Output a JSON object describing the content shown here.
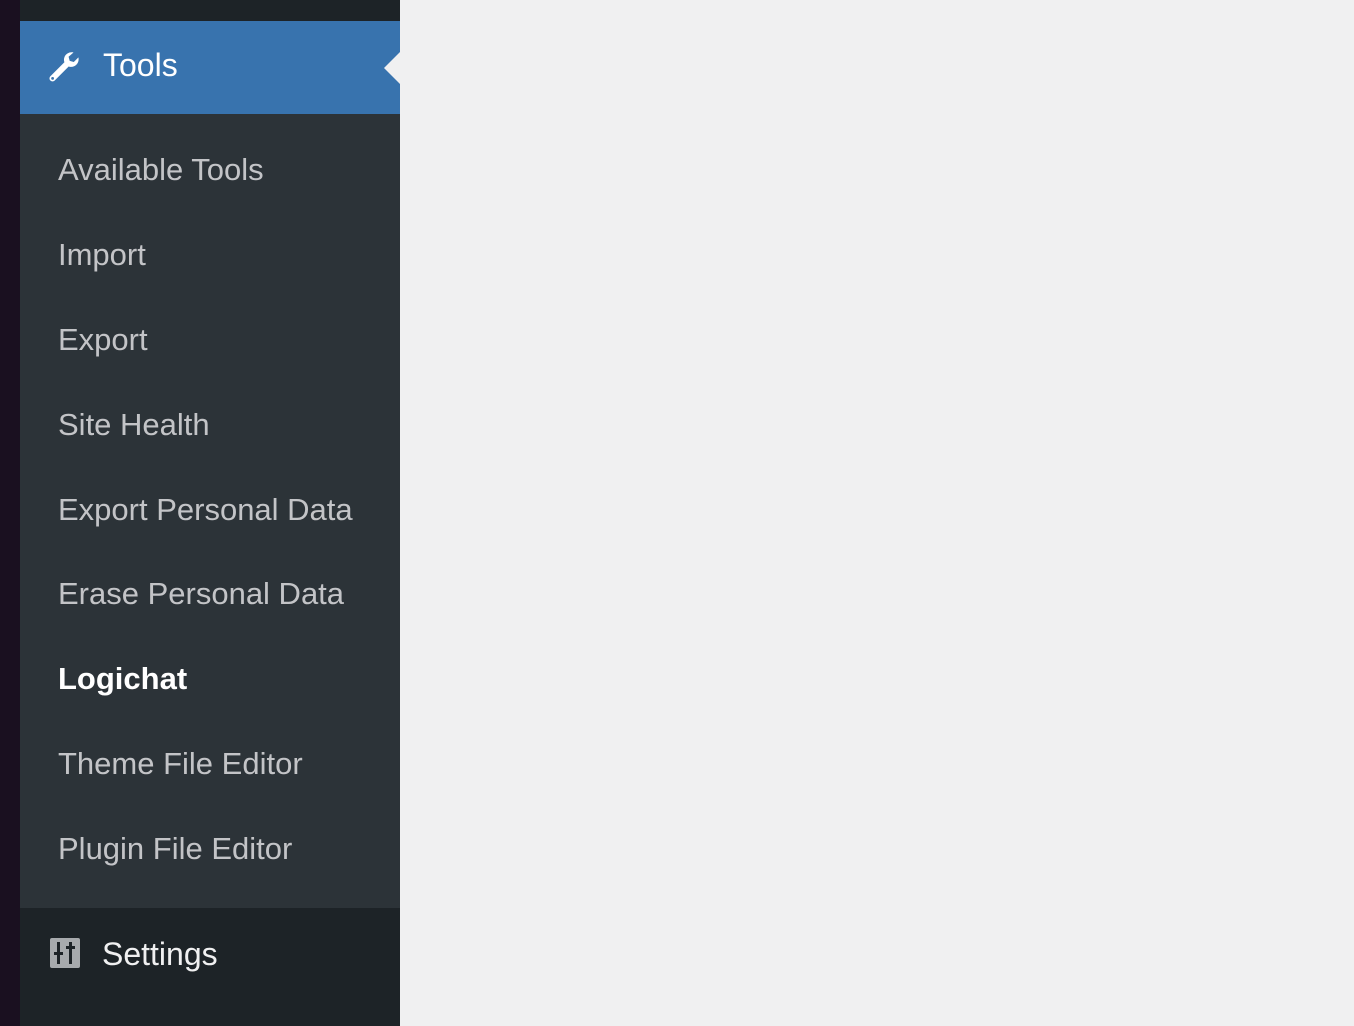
{
  "admin_menu": {
    "tools": {
      "label": "Tools",
      "icon": "wrench-icon"
    },
    "submenu": [
      {
        "label": "Available Tools",
        "current": false
      },
      {
        "label": "Import",
        "current": false
      },
      {
        "label": "Export",
        "current": false
      },
      {
        "label": "Site Health",
        "current": false
      },
      {
        "label": "Export Personal Data",
        "current": false
      },
      {
        "label": "Erase Personal Data",
        "current": false
      },
      {
        "label": "Logichat",
        "current": true
      },
      {
        "label": "Theme File Editor",
        "current": false
      },
      {
        "label": "Plugin File Editor",
        "current": false
      }
    ],
    "settings": {
      "label": "Settings",
      "icon": "sliders-icon"
    }
  },
  "colors": {
    "menu_background": "#1d2327",
    "submenu_background": "#2c3338",
    "active_highlight": "#3873ae",
    "content_background": "#f0f0f1"
  }
}
